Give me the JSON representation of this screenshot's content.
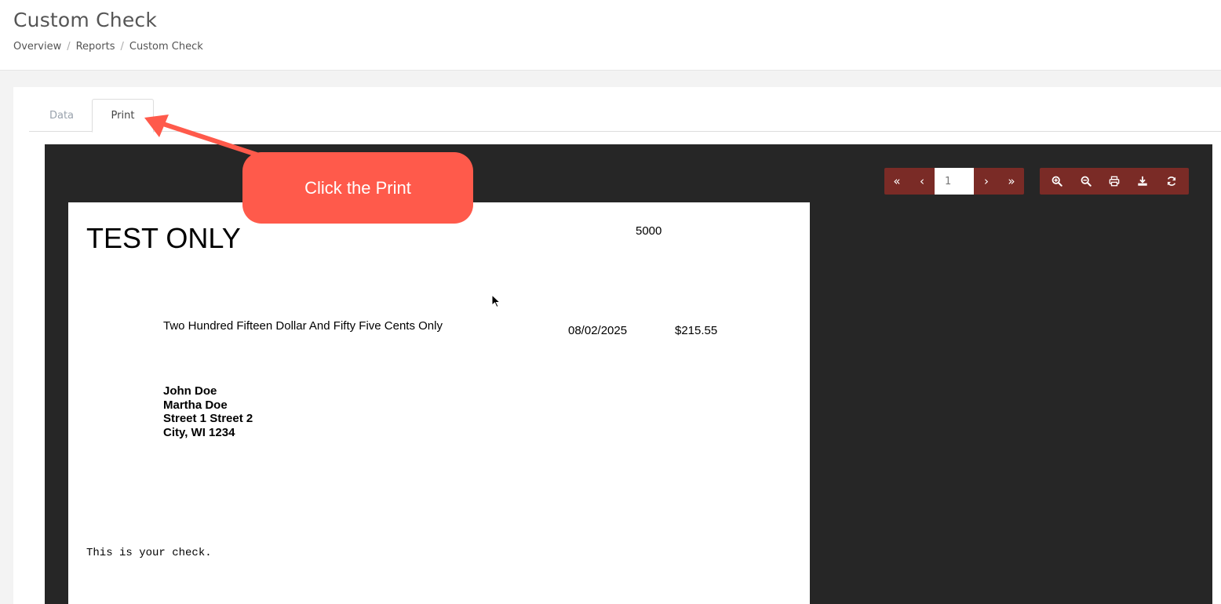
{
  "page": {
    "title": "Custom Check",
    "breadcrumb": [
      "Overview",
      "Reports",
      "Custom Check"
    ],
    "breadcrumb_separator": "/"
  },
  "tabs": [
    {
      "label": "Data",
      "active": false
    },
    {
      "label": "Print",
      "active": true
    }
  ],
  "viewer": {
    "page_number": "1",
    "nav_icons": [
      "first-page-icon",
      "prev-page-icon",
      "next-page-icon",
      "last-page-icon"
    ],
    "tool_icons": [
      "zoom-in-icon",
      "zoom-out-icon",
      "print-icon",
      "download-icon",
      "refresh-icon"
    ],
    "toolbar_color": "#7a2b26",
    "background_color": "#262626"
  },
  "check": {
    "watermark": "TEST ONLY",
    "check_number": "5000",
    "amount_words": "Two Hundred Fifteen Dollar And Fifty Five Cents Only",
    "date": "08/02/2025",
    "amount": "$215.55",
    "payee_lines": [
      "John Doe",
      "Martha Doe",
      "Street 1 Street 2",
      "City, WI 1234"
    ],
    "memo": "This is your check."
  },
  "callout": {
    "text": "Click the Print",
    "color": "#ff5a4b"
  }
}
